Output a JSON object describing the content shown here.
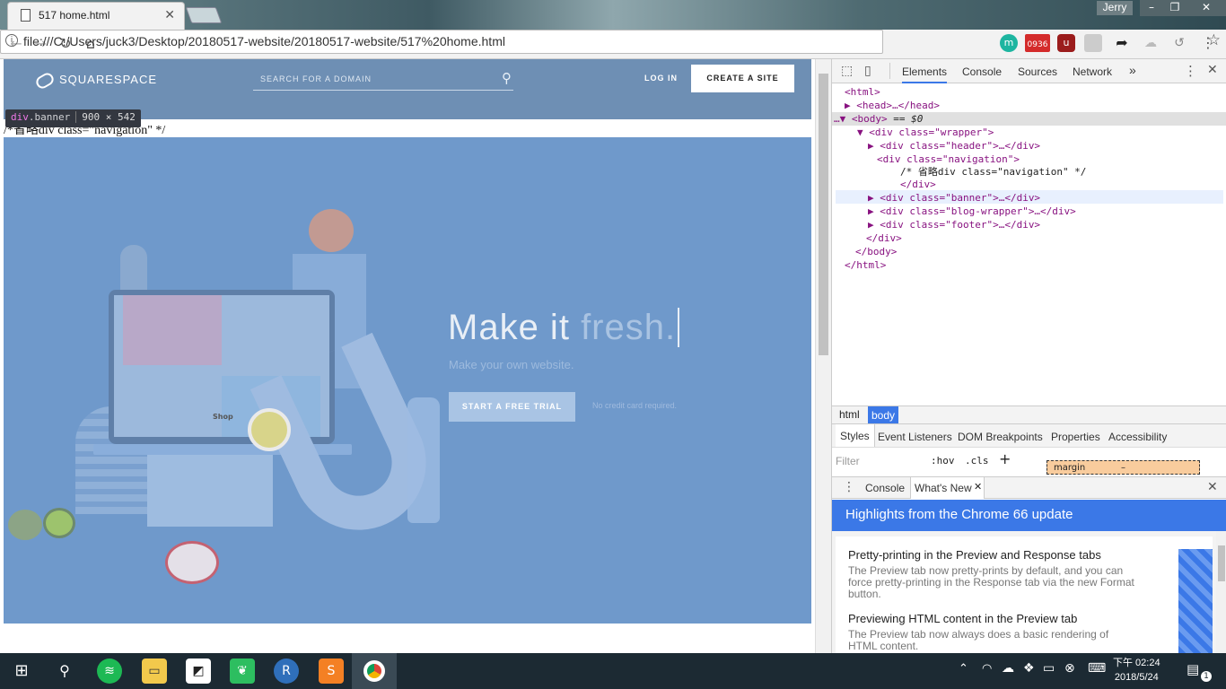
{
  "browser": {
    "tab_title": "517 home.html",
    "user": "Jerry",
    "url": "file:///C:/Users/juck3/Desktop/20180517-website/20180517-website/517%20home.html",
    "ext_badge": "0936"
  },
  "site": {
    "logo": "SQUARESPACE",
    "search_placeholder": "SEARCH FOR A DOMAIN",
    "login": "LOG IN",
    "create": "CREATE A SITE",
    "headline_a": "Make it",
    "headline_b": "fresh.",
    "subline": "Make your own website.",
    "trial": "START A FREE TRIAL",
    "no_cc": "No credit card required.",
    "nav_comment": "/*省略div class=\"navigation\" */",
    "laptop_label": "Shop"
  },
  "inspector_tooltip": {
    "tag": "div",
    "cls": ".banner",
    "size": "900 × 542"
  },
  "devtools": {
    "tabs": [
      "Elements",
      "Console",
      "Sources",
      "Network"
    ],
    "more": "»",
    "dom": {
      "html_open": "<html>",
      "head": "<head>…</head>",
      "body_open": "<body>",
      "body_eq": "== $0",
      "wrapper_open": "<div class=\"wrapper\">",
      "header": "<div class=\"header\">…</div>",
      "nav_open": "<div class=\"navigation\">",
      "nav_comment": "/* 省略div class=\"navigation\" */",
      "div_close": "</div>",
      "banner": "<div class=\"banner\">…</div>",
      "blog": "<div class=\"blog-wrapper\">…</div>",
      "footer": "<div class=\"footer\">…</div>",
      "wrapper_close": "</div>",
      "body_close": "</body>",
      "html_close": "</html>"
    },
    "crumbs": [
      "html",
      "body"
    ],
    "subtabs": [
      "Styles",
      "Event Listeners",
      "DOM Breakpoints",
      "Properties",
      "Accessibility"
    ],
    "filter_placeholder": "Filter",
    "hov": ":hov",
    "cls": ".cls",
    "margin_label": "margin",
    "margin_value": "–",
    "drawer_tabs": [
      "Console",
      "What's New"
    ],
    "whats_new_title": "Highlights from the Chrome 66 update",
    "items": [
      {
        "title": "Pretty-printing in the Preview and Response tabs",
        "body": "The Preview tab now pretty-prints by default, and you can force pretty-printing in the Response tab via the new Format button."
      },
      {
        "title": "Previewing HTML content in the Preview tab",
        "body": "The Preview tab now always does a basic rendering of HTML content."
      }
    ]
  },
  "taskbar": {
    "time": "下午 02:24",
    "date": "2018/5/24",
    "notif_count": "1"
  },
  "colors": {
    "banner": "#6f99cb",
    "header": "#6e8fb4",
    "devtools_blue": "#3b78e7"
  }
}
